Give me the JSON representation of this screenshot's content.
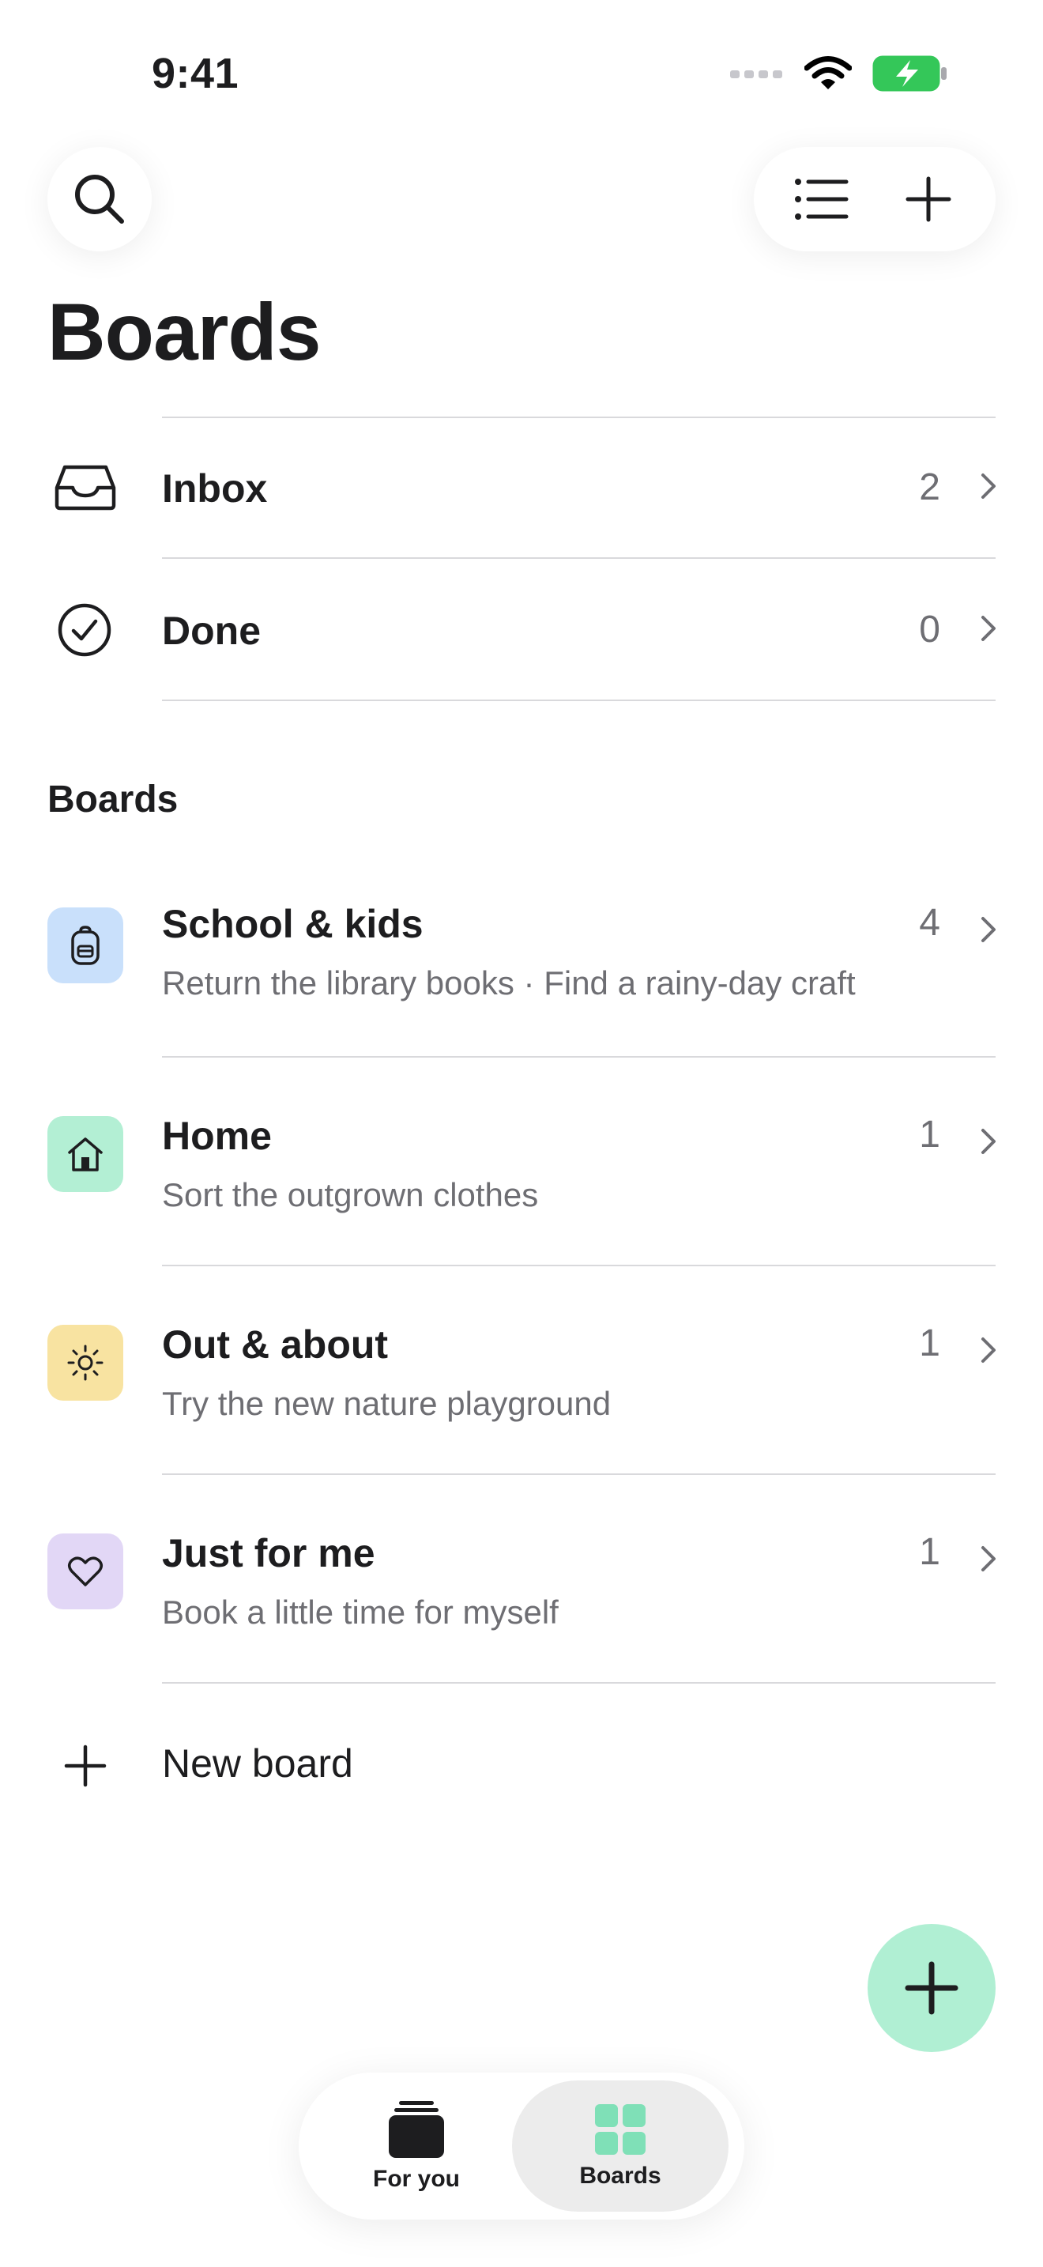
{
  "status_bar": {
    "time": "9:41"
  },
  "header": {
    "title": "Boards"
  },
  "system_lists": [
    {
      "label": "Inbox",
      "count": "2",
      "icon": "inbox-tray-icon"
    },
    {
      "label": "Done",
      "count": "0",
      "icon": "check-circle-icon"
    }
  ],
  "boards_section": {
    "label": "Boards"
  },
  "boards": [
    {
      "title": "School & kids",
      "subtitle": "Return the library books · Find a rainy-day craft",
      "count": "4",
      "icon": "backpack-icon",
      "color": "#c9e0fb"
    },
    {
      "title": "Home",
      "subtitle": "Sort the outgrown clothes",
      "count": "1",
      "icon": "house-icon",
      "color": "#b3efd4"
    },
    {
      "title": "Out & about",
      "subtitle": "Try the new nature playground",
      "count": "1",
      "icon": "sun-icon",
      "color": "#f8e3a1"
    },
    {
      "title": "Just for me",
      "subtitle": "Book a little time for myself",
      "count": "1",
      "icon": "heart-icon",
      "color": "#e2d7f6"
    }
  ],
  "new_board": {
    "label": "New board"
  },
  "tabbar": {
    "tabs": [
      {
        "label": "For you",
        "icon": "card-stack-icon"
      },
      {
        "label": "Boards",
        "icon": "grid-icon",
        "active": true
      }
    ]
  },
  "colors": {
    "accent": "#b0efd3",
    "accent_icon": "#7fe0b7",
    "battery": "#34c759"
  }
}
